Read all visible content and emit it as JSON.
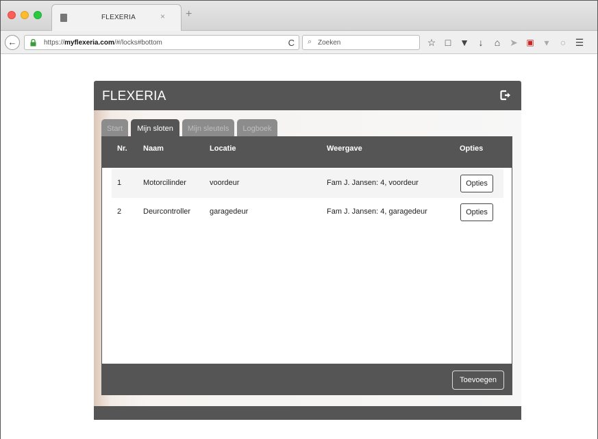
{
  "browser": {
    "tab_title": "FLEXERIA",
    "tab_close": "×",
    "new_tab": "+",
    "url_prefix": "https://",
    "url_domain": "myflexeria.com",
    "url_path": "/#/locks#bottom",
    "search_placeholder": "Zoeken",
    "back_glyph": "←",
    "reload_glyph": "C",
    "icons": [
      "bookmark-star-icon",
      "reading-list-icon",
      "pocket-icon",
      "download-icon",
      "home-icon",
      "send-icon",
      "translate-icon",
      "chat-icon",
      "menu-icon"
    ]
  },
  "app": {
    "title": "FLEXERIA",
    "tabs": [
      {
        "label": "Start",
        "active": false
      },
      {
        "label": "Mijn sloten",
        "active": true
      },
      {
        "label": "Mijn sleutels",
        "active": false
      },
      {
        "label": "Logboek",
        "active": false
      }
    ],
    "table": {
      "headers": [
        "Nr.",
        "Naam",
        "Locatie",
        "Weergave",
        "Opties"
      ],
      "rows": [
        {
          "nr": "1",
          "naam": "Motorcilinder",
          "locatie": "voordeur",
          "weergave": "Fam J. Jansen: 4, voordeur",
          "opties": "Opties"
        },
        {
          "nr": "2",
          "naam": "Deurcontroller",
          "locatie": "garagedeur",
          "weergave": "Fam J. Jansen: 4, garagedeur",
          "opties": "Opties"
        }
      ]
    },
    "add_button": "Toevoegen"
  },
  "colors": {
    "header": "#555555",
    "tab_inactive": "#8c8c8c",
    "row_stripe": "#f4f4f4"
  }
}
